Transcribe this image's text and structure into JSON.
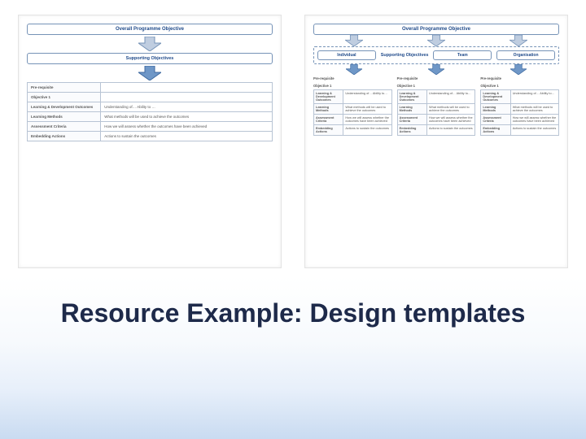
{
  "colors": {
    "arrowFill": "#bfcde0",
    "arrowStroke": "#7693b7",
    "arrowFill2": "#6f97c7"
  },
  "title": "Resource Example: Design templates",
  "leftPanel": {
    "overall": "Overall Programme Objective",
    "supporting": "Supporting Objectives",
    "rows": [
      {
        "label": "Pre-requisite",
        "value": ""
      },
      {
        "label": "Objective 1",
        "value": ""
      },
      {
        "label": "Learning & Development Outcomes",
        "value": "Understanding of…\nAbility to …"
      },
      {
        "label": "Learning Methods",
        "value": "What methods will be used to achieve the outcomes"
      },
      {
        "label": "Assessment Criteria",
        "value": "How we will assess whether the outcomes have been achieved"
      },
      {
        "label": "Embedding Actions",
        "value": "Actions to sustain the outcomes"
      }
    ]
  },
  "rightPanel": {
    "overall": "Overall Programme Objective",
    "supporting": "Supporting Objectives",
    "columns": [
      {
        "name": "Individual",
        "prereq": "Pre-requisite",
        "objective": "Objective 1",
        "rows": [
          {
            "l": "Learning & Development Outcomes",
            "r": "Understanding of…\nAbility to…"
          },
          {
            "l": "Learning Methods",
            "r": "What methods will be used to achieve the outcomes"
          },
          {
            "l": "Assessment Criteria",
            "r": "How we will assess whether the outcomes have been achieved"
          },
          {
            "l": "Embedding Actions",
            "r": "Actions to sustain the outcomes"
          }
        ]
      },
      {
        "name": "Team",
        "prereq": "Pre-requisite",
        "objective": "Objective 1",
        "rows": [
          {
            "l": "Learning & Development Outcomes",
            "r": "Understanding of…\nAbility to…"
          },
          {
            "l": "Learning Methods",
            "r": "What methods will be used to achieve the outcomes"
          },
          {
            "l": "Assessment Criteria",
            "r": "How we will assess whether the outcomes have been achieved"
          },
          {
            "l": "Embedding Actions",
            "r": "Actions to sustain the outcomes"
          }
        ]
      },
      {
        "name": "Organisation",
        "prereq": "Pre-requisite",
        "objective": "Objective 1",
        "rows": [
          {
            "l": "Learning & Development Outcomes",
            "r": "Understanding of…\nAbility to…"
          },
          {
            "l": "Learning Methods",
            "r": "What methods will be used to achieve the outcomes"
          },
          {
            "l": "Assessment Criteria",
            "r": "How we will assess whether the outcomes have been achieved"
          },
          {
            "l": "Embedding Actions",
            "r": "Actions to sustain the outcomes"
          }
        ]
      }
    ]
  }
}
